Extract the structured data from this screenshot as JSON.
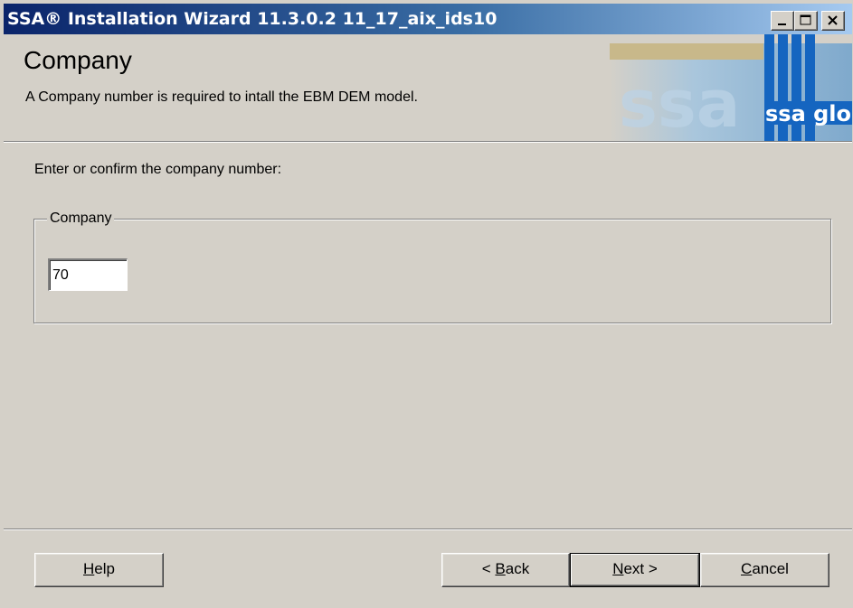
{
  "window": {
    "title": "SSA® Installation Wizard 11.3.0.2 11_17_aix_ids10"
  },
  "header": {
    "title": "Company",
    "description": "A Company number is required to intall the EBM DEM model.",
    "logo_text": "ssa global"
  },
  "body": {
    "prompt": "Enter or confirm the company number:",
    "group_label": "Company",
    "company_value": "70"
  },
  "buttons": {
    "help": {
      "mnemonic": "H",
      "rest": "elp"
    },
    "back": {
      "prefix": "< ",
      "mnemonic": "B",
      "rest": "ack"
    },
    "next": {
      "mnemonic": "N",
      "rest": "ext >"
    },
    "cancel": {
      "mnemonic": "C",
      "rest": "ancel"
    }
  },
  "colors": {
    "titlebar_start": "#0a246a",
    "titlebar_end": "#a6caf0",
    "dialog_bg": "#d4d0c8",
    "logo_blue": "#1565c0",
    "logo_tan": "#c8b88a"
  },
  "icons": {
    "minimize": "minimize-icon",
    "maximize": "maximize-icon",
    "close": "close-icon"
  }
}
